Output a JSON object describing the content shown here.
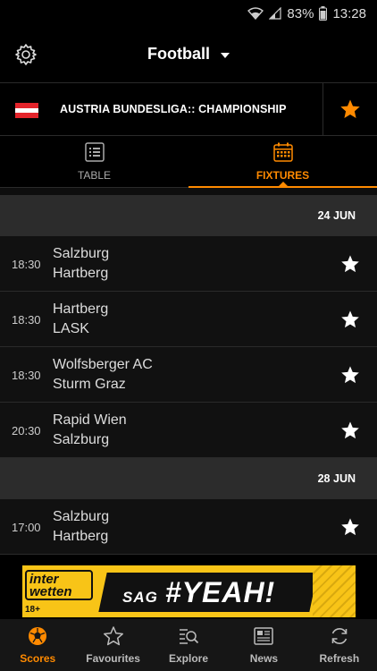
{
  "status_bar": {
    "battery": "83%",
    "time": "13:28"
  },
  "header": {
    "title": "Football",
    "settings_icon": "gear-icon",
    "dropdown_icon": "caret-down-icon"
  },
  "league": {
    "name": "AUSTRIA BUNDESLIGA:: CHAMPIONSHIP",
    "flag_colors": [
      "#e3242b",
      "#ffffff",
      "#e3242b"
    ],
    "favourite": true,
    "favourite_color": "#ff8a00"
  },
  "tabs": [
    {
      "label": "TABLE",
      "icon": "list-icon",
      "active": false
    },
    {
      "label": "FIXTURES",
      "icon": "calendar-icon",
      "active": true
    }
  ],
  "accent_color": "#ff8a00",
  "fixture_days": [
    {
      "date": "24 JUN",
      "fixtures": [
        {
          "time": "18:30",
          "home": "Salzburg",
          "away": "Hartberg"
        },
        {
          "time": "18:30",
          "home": "Hartberg",
          "away": "LASK"
        },
        {
          "time": "18:30",
          "home": "Wolfsberger AC",
          "away": "Sturm Graz"
        },
        {
          "time": "20:30",
          "home": "Rapid Wien",
          "away": "Salzburg"
        }
      ]
    },
    {
      "date": "28 JUN",
      "fixtures": [
        {
          "time": "17:00",
          "home": "Salzburg",
          "away": "Hartberg"
        }
      ]
    }
  ],
  "ad": {
    "brand_line1": "inter",
    "brand_line2": "wetten",
    "age": "18+",
    "slogan_small": "SAG",
    "slogan_big": "#YEAH!"
  },
  "bottom_nav": [
    {
      "label": "Scores",
      "icon": "football-icon",
      "active": true
    },
    {
      "label": "Favourites",
      "icon": "star-outline-icon",
      "active": false
    },
    {
      "label": "Explore",
      "icon": "explore-icon",
      "active": false
    },
    {
      "label": "News",
      "icon": "news-icon",
      "active": false
    },
    {
      "label": "Refresh",
      "icon": "refresh-icon",
      "active": false
    }
  ]
}
